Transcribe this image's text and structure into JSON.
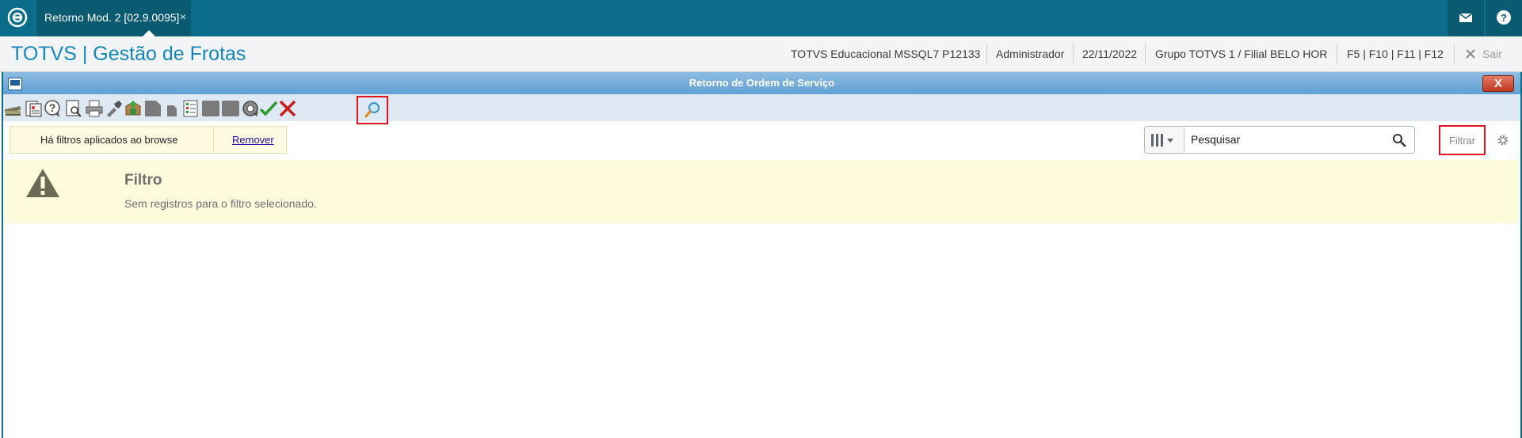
{
  "topbar": {
    "tab_title": "Retorno Mod. 2 [02.9.0095]",
    "tab_close": "×",
    "icons": [
      "totvs-logo-icon",
      "mail-icon",
      "help-icon"
    ]
  },
  "header": {
    "app_title": "TOTVS | Gestão de Frotas",
    "environment": "TOTVS Educacional MSSQL7 P12133",
    "user": "Administrador",
    "date": "22/11/2022",
    "branch": "Grupo TOTVS 1 / Filial BELO HOR",
    "shortcuts": "F5 | F10 | F11 | F12",
    "exit_label": "Sair"
  },
  "window": {
    "title": "Retorno de Ordem de Serviço",
    "close_label": "X"
  },
  "toolbar": {
    "buttons": [
      "books-icon",
      "report-icon",
      "help-icon",
      "preview-icon",
      "print-icon",
      "tools-icon",
      "export-icon",
      "document-icon",
      "page-icon",
      "checklist-icon",
      "panel-icon",
      "panel-icon",
      "settings-icon",
      "confirm-icon",
      "cancel-icon",
      "search-icon"
    ]
  },
  "filter": {
    "message": "Há filtros aplicados ao browse",
    "remove_label": "Remover"
  },
  "search": {
    "placeholder": "Pesquisar",
    "value": "Pesquisar"
  },
  "actions": {
    "filter_label": "Filtrar"
  },
  "empty_state": {
    "title": "Filtro",
    "message": "Sem registros para o filtro selecionado."
  },
  "colors": {
    "topbar": "#0b6d8a",
    "title_blue": "#1487b8",
    "highlight_red": "#e0141e",
    "banner_yellow": "#fdfbdc"
  }
}
